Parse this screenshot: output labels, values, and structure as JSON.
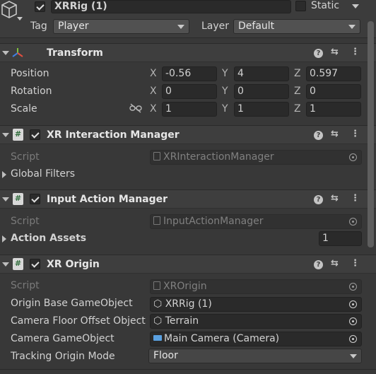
{
  "gameobject": {
    "name": "XRRig (1)",
    "active": true,
    "static_label": "Static",
    "tag_label": "Tag",
    "tag_value": "Player",
    "layer_label": "Layer",
    "layer_value": "Default"
  },
  "transform": {
    "title": "Transform",
    "axes": {
      "x": "X",
      "y": "Y",
      "z": "Z"
    },
    "rows": [
      {
        "label": "Position",
        "x": "-0.56",
        "y": "4",
        "z": "0.597"
      },
      {
        "label": "Rotation",
        "x": "0",
        "y": "0",
        "z": "0"
      },
      {
        "label": "Scale",
        "x": "1",
        "y": "1",
        "z": "1"
      }
    ]
  },
  "xr_interaction_manager": {
    "title": "XR Interaction Manager",
    "enabled": true,
    "script_label": "Script",
    "script_value": "XRInteractionManager",
    "global_filters_label": "Global Filters"
  },
  "input_action_manager": {
    "title": "Input Action Manager",
    "enabled": true,
    "script_label": "Script",
    "script_value": "InputActionManager",
    "action_assets_label": "Action Assets",
    "action_assets_count": "1"
  },
  "xr_origin": {
    "title": "XR Origin",
    "enabled": true,
    "script_label": "Script",
    "script_value": "XROrigin",
    "fields": [
      {
        "label": "Origin Base GameObject",
        "value": "XRRig (1)",
        "icon": "cube-icon"
      },
      {
        "label": "Camera Floor Offset Object",
        "value": "Terrain",
        "icon": "cube-icon"
      },
      {
        "label": "Camera GameObject",
        "value": "Main Camera (Camera)",
        "icon": "camera-icon"
      }
    ],
    "tracking_origin_label": "Tracking Origin Mode",
    "tracking_origin_value": "Floor"
  },
  "colors": {
    "background": "#383838",
    "header": "#3e3e3e",
    "field": "#2a2a2a"
  }
}
